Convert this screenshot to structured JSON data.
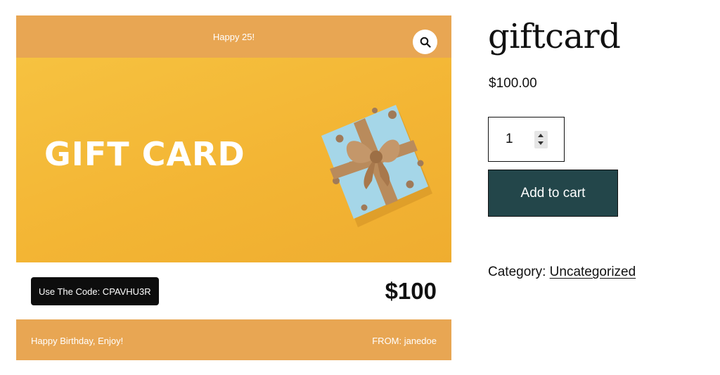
{
  "card": {
    "header_text": "Happy 25!",
    "image_title": "GIFT CARD",
    "code_label": "Use The Code: CPAVHU3R",
    "amount": "$100",
    "message": "Happy Birthday, Enjoy!",
    "from": "FROM: janedoe",
    "colors": {
      "band": "#e8a653",
      "image_bg": "#f3b534",
      "box": "#9fd3e6",
      "ribbon": "#b9895a"
    },
    "zoom_icon": "search-icon"
  },
  "product": {
    "title": "giftcard",
    "price": "$100.00",
    "quantity": "1",
    "add_to_cart_label": "Add to cart",
    "category_label": "Category:",
    "category_value": "Uncategorized",
    "colors": {
      "button_bg": "#23464a"
    }
  }
}
